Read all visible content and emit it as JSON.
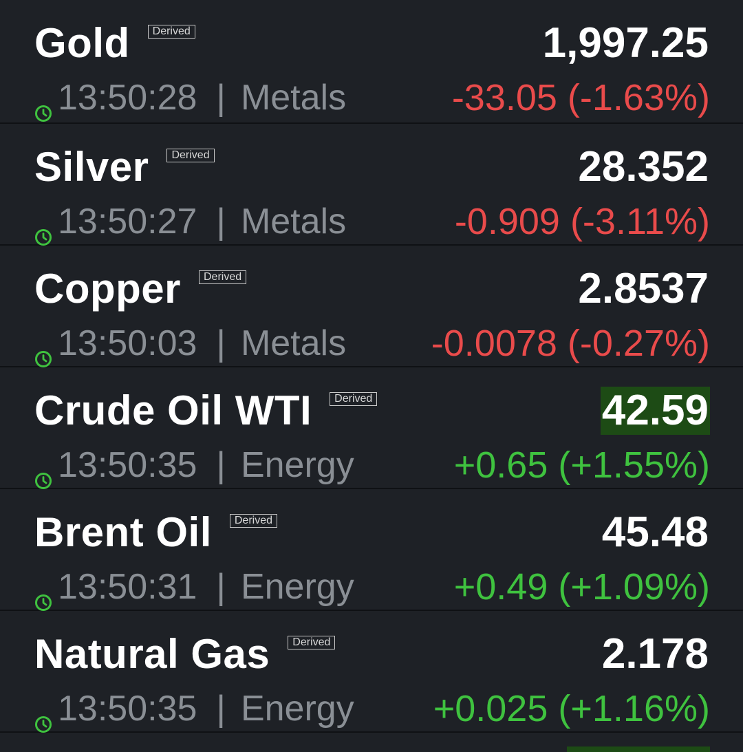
{
  "colors": {
    "background": "#1e2126",
    "down": "#e94b4b",
    "up": "#3fc23f",
    "flash": "#1d4b15",
    "clock": "#3fc23f"
  },
  "badge_label": "Derived",
  "quotes": [
    {
      "name": "Gold",
      "price": "1,997.25",
      "time": "13:50:28",
      "category": "Metals",
      "change": "-33.05 (-1.63%)",
      "direction": "down",
      "flash": false
    },
    {
      "name": "Silver",
      "price": "28.352",
      "time": "13:50:27",
      "category": "Metals",
      "change": "-0.909 (-3.11%)",
      "direction": "down",
      "flash": false
    },
    {
      "name": "Copper",
      "price": "2.8537",
      "time": "13:50:03",
      "category": "Metals",
      "change": "-0.0078 (-0.27%)",
      "direction": "down",
      "flash": false
    },
    {
      "name": "Crude Oil WTI",
      "price": "42.59",
      "time": "13:50:35",
      "category": "Energy",
      "change": "+0.65 (+1.55%)",
      "direction": "up",
      "flash": true
    },
    {
      "name": "Brent Oil",
      "price": "45.48",
      "time": "13:50:31",
      "category": "Energy",
      "change": "+0.49 (+1.09%)",
      "direction": "up",
      "flash": false
    },
    {
      "name": "Natural Gas",
      "price": "2.178",
      "time": "13:50:35",
      "category": "Energy",
      "change": "+0.025 (+1.16%)",
      "direction": "up",
      "flash": false
    }
  ]
}
